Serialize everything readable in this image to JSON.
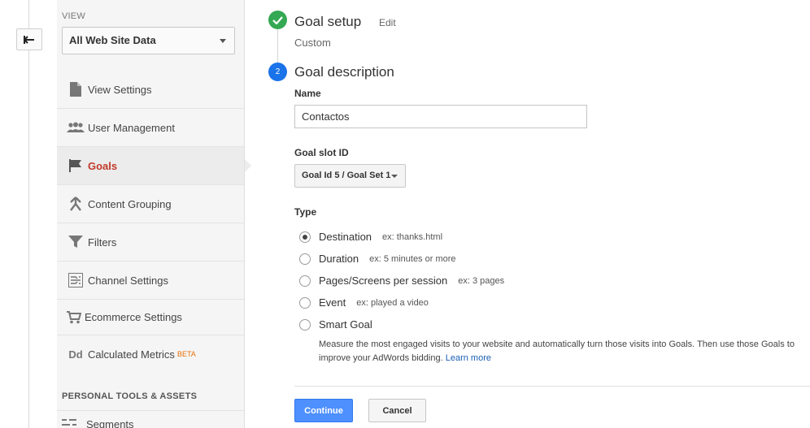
{
  "back": {
    "icon": "back-arrow-icon"
  },
  "sidebar": {
    "view_label": "VIEW",
    "view_value": "All Web Site Data",
    "items": [
      {
        "label": "View Settings",
        "icon": "document-icon"
      },
      {
        "label": "User Management",
        "icon": "users-icon"
      },
      {
        "label": "Goals",
        "icon": "flag-icon",
        "active": true
      },
      {
        "label": "Content Grouping",
        "icon": "content-grouping-icon"
      },
      {
        "label": "Filters",
        "icon": "filter-icon"
      },
      {
        "label": "Channel Settings",
        "icon": "channel-settings-icon"
      },
      {
        "label": "Ecommerce Settings",
        "icon": "cart-icon"
      },
      {
        "label": "Calculated Metrics",
        "icon": "dd-icon",
        "badge": "BETA"
      }
    ],
    "section_label": "PERSONAL TOOLS & ASSETS",
    "segments_label": "Segments"
  },
  "goal": {
    "step1": {
      "title": "Goal setup",
      "edit": "Edit",
      "subtitle": "Custom"
    },
    "step2": {
      "number": "2",
      "title": "Goal description"
    },
    "name_label": "Name",
    "name_value": "Contactos",
    "slot_label": "Goal slot ID",
    "slot_value": "Goal Id 5 / Goal Set 1",
    "type_label": "Type",
    "types": [
      {
        "label": "Destination",
        "example": "ex: thanks.html",
        "selected": true
      },
      {
        "label": "Duration",
        "example": "ex: 5 minutes or more"
      },
      {
        "label": "Pages/Screens per session",
        "example": "ex: 3 pages"
      },
      {
        "label": "Event",
        "example": "ex: played a video"
      },
      {
        "label": "Smart Goal",
        "example": ""
      }
    ],
    "smart_desc": "Measure the most engaged visits to your website and automatically turn those visits into Goals. Then use those Goals to improve your AdWords bidding.",
    "learn_more": "Learn more",
    "continue": "Continue",
    "cancel": "Cancel"
  },
  "colors": {
    "accent": "#4d90fe",
    "active_nav": "#c0392b",
    "check": "#34a853",
    "step_badge": "#1a73e8"
  }
}
